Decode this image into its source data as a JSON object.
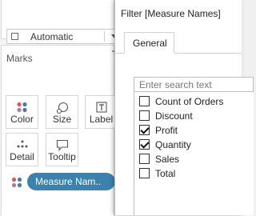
{
  "marks": {
    "title": "Marks",
    "mark_type": "Automatic",
    "buttons": [
      {
        "label": "Color",
        "icon": "color-dots-icon"
      },
      {
        "label": "Size",
        "icon": "size-icon"
      },
      {
        "label": "Label",
        "icon": "label-icon"
      },
      {
        "label": "Detail",
        "icon": "detail-icon"
      },
      {
        "label": "Tooltip",
        "icon": "tooltip-icon"
      }
    ],
    "pill": "Measure Nam.."
  },
  "dialog": {
    "title": "Filter [Measure Names]",
    "tab": "General",
    "search_placeholder": "Enter search text",
    "options": [
      {
        "label": "Count of Orders",
        "checked": false
      },
      {
        "label": "Discount",
        "checked": false
      },
      {
        "label": "Profit",
        "checked": true
      },
      {
        "label": "Quantity",
        "checked": true
      },
      {
        "label": "Sales",
        "checked": false
      },
      {
        "label": "Total",
        "checked": false
      }
    ]
  },
  "colors": {
    "pill": "#3c82ad",
    "dot_red": "#e15759",
    "dot_blue": "#4e79a7",
    "dot_purple": "#b07aa1"
  }
}
